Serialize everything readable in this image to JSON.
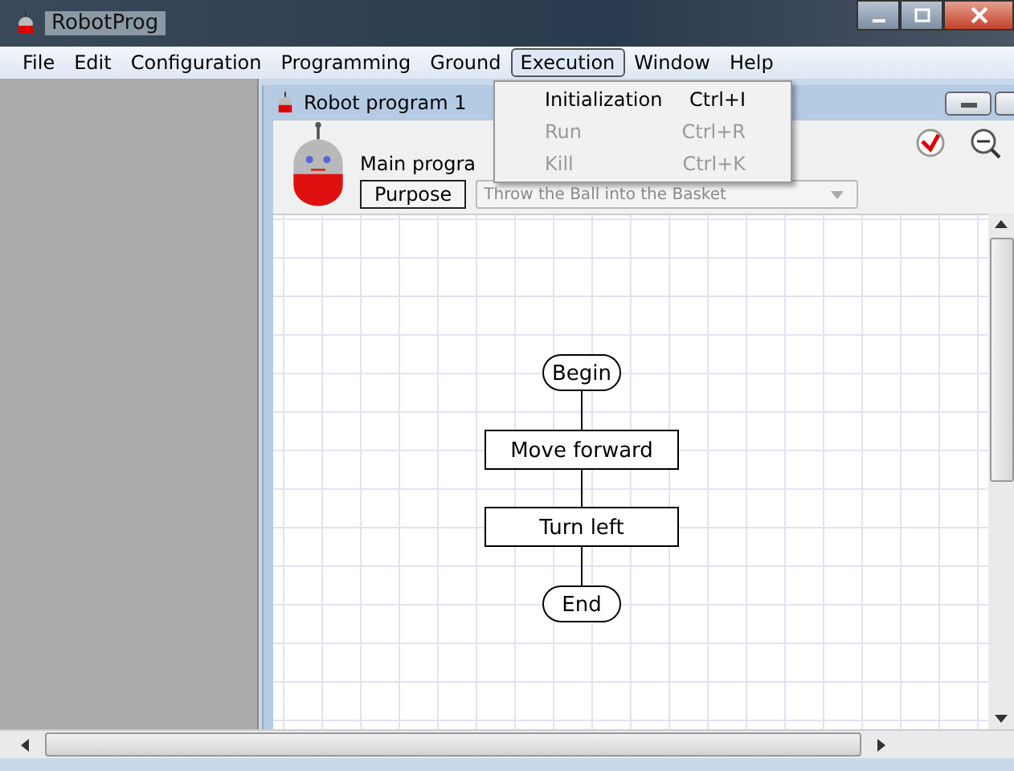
{
  "window": {
    "title": "RobotProg"
  },
  "menu_bar": [
    {
      "label": "File",
      "selected": false
    },
    {
      "label": "Edit",
      "selected": false
    },
    {
      "label": "Configuration",
      "selected": false
    },
    {
      "label": "Programming",
      "selected": false
    },
    {
      "label": "Ground",
      "selected": false
    },
    {
      "label": "Execution",
      "selected": true
    },
    {
      "label": "Window",
      "selected": false
    },
    {
      "label": "Help",
      "selected": false
    }
  ],
  "dropdown_menu": [
    {
      "label": "Initialization",
      "shortcut": "Ctrl+I",
      "disabled": false
    },
    {
      "label": "Run",
      "shortcut": "Ctrl+R",
      "disabled": true
    },
    {
      "label": "Kill",
      "shortcut": "Ctrl+K",
      "disabled": true
    }
  ],
  "child_window": {
    "title": "Robot program 1",
    "program_label": "Main progra",
    "purpose_button": "Purpose",
    "purpose_field": {
      "value": "Throw the Ball into the Basket",
      "disabled": true
    }
  },
  "flowchart": [
    {
      "kind": "terminal",
      "label": "Begin"
    },
    {
      "kind": "action",
      "label": "Move forward"
    },
    {
      "kind": "action",
      "label": "Turn left"
    },
    {
      "kind": "terminal",
      "label": "End"
    }
  ]
}
